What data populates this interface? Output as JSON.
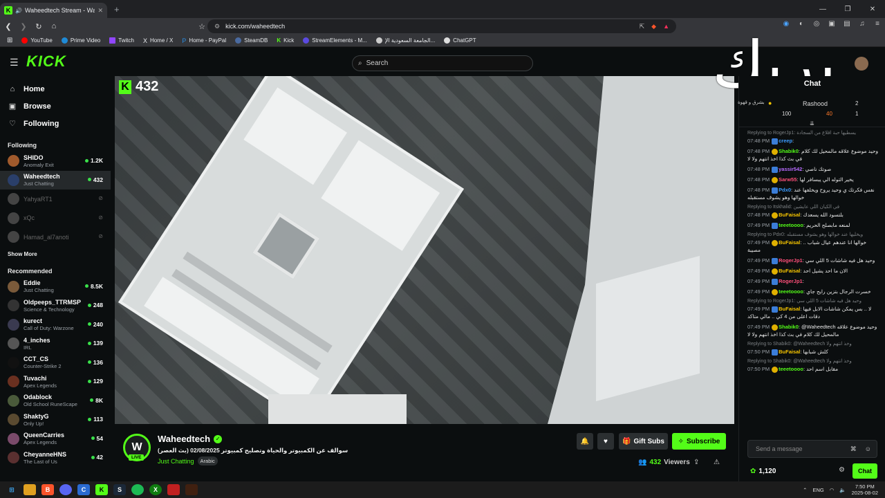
{
  "browser": {
    "tab_title": "Waheedtech Stream - Watch ...",
    "url": "kick.com/waheedtech",
    "bookmarks": [
      "YouTube",
      "Prime Video",
      "Twitch",
      "Home / X",
      "Home - PayPal",
      "SteamDB",
      "Kick",
      "StreamElements - M...",
      "الجامعة السعودية الإ...",
      "ChatGPT"
    ]
  },
  "kick": {
    "logo": "KICK",
    "search_placeholder": "Search",
    "overlay_text": "بريك"
  },
  "sidebar": {
    "nav": [
      {
        "label": "Home",
        "icon": "house-icon"
      },
      {
        "label": "Browse",
        "icon": "browse-icon"
      },
      {
        "label": "Following",
        "icon": "heart-icon"
      }
    ],
    "following_title": "Following",
    "following": [
      {
        "name": "SHIDO",
        "category": "Anomaly Exit",
        "viewers": "1.2K",
        "live": true,
        "color": "#a05a2c"
      },
      {
        "name": "Waheedtech",
        "category": "Just Chatting",
        "viewers": "432",
        "live": true,
        "color": "#2a3f6a",
        "selected": true
      },
      {
        "name": "YahyaRT1",
        "category": "",
        "viewers": "",
        "live": false,
        "color": "#444"
      },
      {
        "name": "xQc",
        "category": "",
        "viewers": "",
        "live": false,
        "color": "#444"
      },
      {
        "name": "Hamad_al7anoti",
        "category": "",
        "viewers": "",
        "live": false,
        "color": "#444"
      }
    ],
    "show_more": "Show More",
    "recommended_title": "Recommended",
    "recommended": [
      {
        "name": "Eddie",
        "category": "Just Chatting",
        "viewers": "8.5K",
        "color": "#7a5a3a"
      },
      {
        "name": "Oldpeeps_TTRMSP",
        "category": "Science & Technology",
        "viewers": "248",
        "color": "#333"
      },
      {
        "name": "kurect",
        "category": "Call of Duty: Warzone",
        "viewers": "240",
        "color": "#3a3a50"
      },
      {
        "name": "4_inches",
        "category": "IRL",
        "viewers": "139",
        "color": "#555"
      },
      {
        "name": "CCT_CS",
        "category": "Counter-Strike 2",
        "viewers": "136",
        "color": "#111"
      },
      {
        "name": "Tuvachi",
        "category": "Apex Legends",
        "viewers": "129",
        "color": "#6a3020"
      },
      {
        "name": "Odablock",
        "category": "Old School RuneScape",
        "viewers": "8K",
        "color": "#4a5a3a"
      },
      {
        "name": "ShaktyG",
        "category": "Only Up!",
        "viewers": "113",
        "color": "#5a4a30"
      },
      {
        "name": "QueenCarries",
        "category": "Apex Legends",
        "viewers": "54",
        "color": "#7a4a6a"
      },
      {
        "name": "CheyanneHNS",
        "category": "The Last of Us",
        "viewers": "42",
        "color": "#5a3030"
      }
    ]
  },
  "player": {
    "viewer_badge": "432"
  },
  "stream": {
    "streamer": "Waheedtech",
    "avatar_letter": "W",
    "live_label": "LIVE",
    "title": "سوالف عن الكمبيوتر والحياة وتصليح كمبيوتر 02/08/2025 (بث العصر)",
    "category": "Just Chatting",
    "tag": "Arabic",
    "gift_label": "Gift Subs",
    "subscribe_label": "Subscribe",
    "viewers_count": "432",
    "viewers_label": "Viewers"
  },
  "chat": {
    "header": "Chat",
    "pinned": {
      "user": "Rashood",
      "n1": "100",
      "n2": "2",
      "n3": "1",
      "n4": "40",
      "preview": "بشرق و قهوة"
    },
    "messages": [
      {
        "reply": "Replying to RogerJp1: يسطيها حبة اقلاع من السجادة",
        "time": "07:48 PM",
        "user": "creep",
        "color": "#3b9cff",
        "text": ""
      },
      {
        "reply": "",
        "time": "07:48 PM",
        "user": "Shabik0",
        "color": "#53fc18",
        "text": "وحيد موضوع علاقه مالمحيل لك كلام في بث كذا اخذ انتهم ولا لا"
      },
      {
        "reply": "",
        "time": "07:48 PM",
        "user": "yassir542",
        "color": "#b86bff",
        "text": "صوتك ناصي"
      },
      {
        "reply": "",
        "time": "07:48 PM",
        "user": "Sarw55",
        "color": "#ff4f7a",
        "text": "يخير التوله الي يبسافر لها"
      },
      {
        "reply": "",
        "time": "07:48 PM",
        "user": "Pdx0",
        "color": "#3b9cff",
        "text": "نفس فكرتك ي وحيد يروح ويخلفها عند خوالها وهو يشوف مستقبله"
      },
      {
        "reply": "Replying to Itskhalid: في الكيان اللي عايشين",
        "time": "07:48 PM",
        "user": "BuFaisal",
        "color": "#f5c400",
        "text": "بلتسود الله يسعدك"
      },
      {
        "reply": "",
        "time": "07:49 PM",
        "user": "teeetoooo",
        "color": "#53fc18",
        "text": "لمنعه مابصلح الحريم"
      },
      {
        "reply": "Replying to Pdx0: ويخليها عند خوالها وهو يشوف مستقبله",
        "time": "07:49 PM",
        "user": "BuFaisal",
        "color": "#f5c400",
        "text": "خوالها انا عندهم عيال شباب .. مصيبة"
      },
      {
        "reply": "",
        "time": "07:49 PM",
        "user": "RogerJp1",
        "color": "#ff4f7a",
        "text": "وحيد هل فيه شاشات 5 اللي سي"
      },
      {
        "reply": "",
        "time": "07:49 PM",
        "user": "BuFaisal",
        "color": "#f5c400",
        "text": "الان ما احد يشيل احد"
      },
      {
        "reply": "",
        "time": "07:49 PM",
        "user": "RogerJp1",
        "color": "#ff4f7a",
        "text": ""
      },
      {
        "reply": "",
        "time": "07:49 PM",
        "user": "teeetoooo",
        "color": "#53fc18",
        "text": "خسرت الرجال بتزين رايح جاي"
      },
      {
        "reply": "Replying to RogerJp1: وحيد هل فيه شاشات 5 اللي سي",
        "time": "07:49 PM",
        "user": "BuFaisal",
        "color": "#f5c400",
        "text": "لا .. بس يمكن شاشات الابل فيها دقات اعلى من 4 كي .. مالي متاكد"
      },
      {
        "reply": "",
        "time": "07:49 PM",
        "user": "Shabik0",
        "color": "#53fc18",
        "text": "@Waheedtech وحيد موضوع علاقه مالمحيل لك كلام في بث كذا اخذ انتهم ولا لا"
      },
      {
        "reply": "Replying to Shabik0: @Waheedtech وخذ انتهم ولا",
        "time": "07:50 PM",
        "user": "BuFaisal",
        "color": "#f5c400",
        "text": "كلش شبابها"
      },
      {
        "reply": "Replying to Shabik0: @Waheedtech وخذ انتهم ولا",
        "time": "07:50 PM",
        "user": "teeetoooo",
        "color": "#53fc18",
        "text": "مقابل اسم احد"
      }
    ],
    "input_placeholder": "Send a message",
    "points": "1,120",
    "chat_button": "Chat"
  },
  "taskbar": {
    "lang": "ENG",
    "time": "7:50 PM",
    "date": "2025-08-02"
  }
}
